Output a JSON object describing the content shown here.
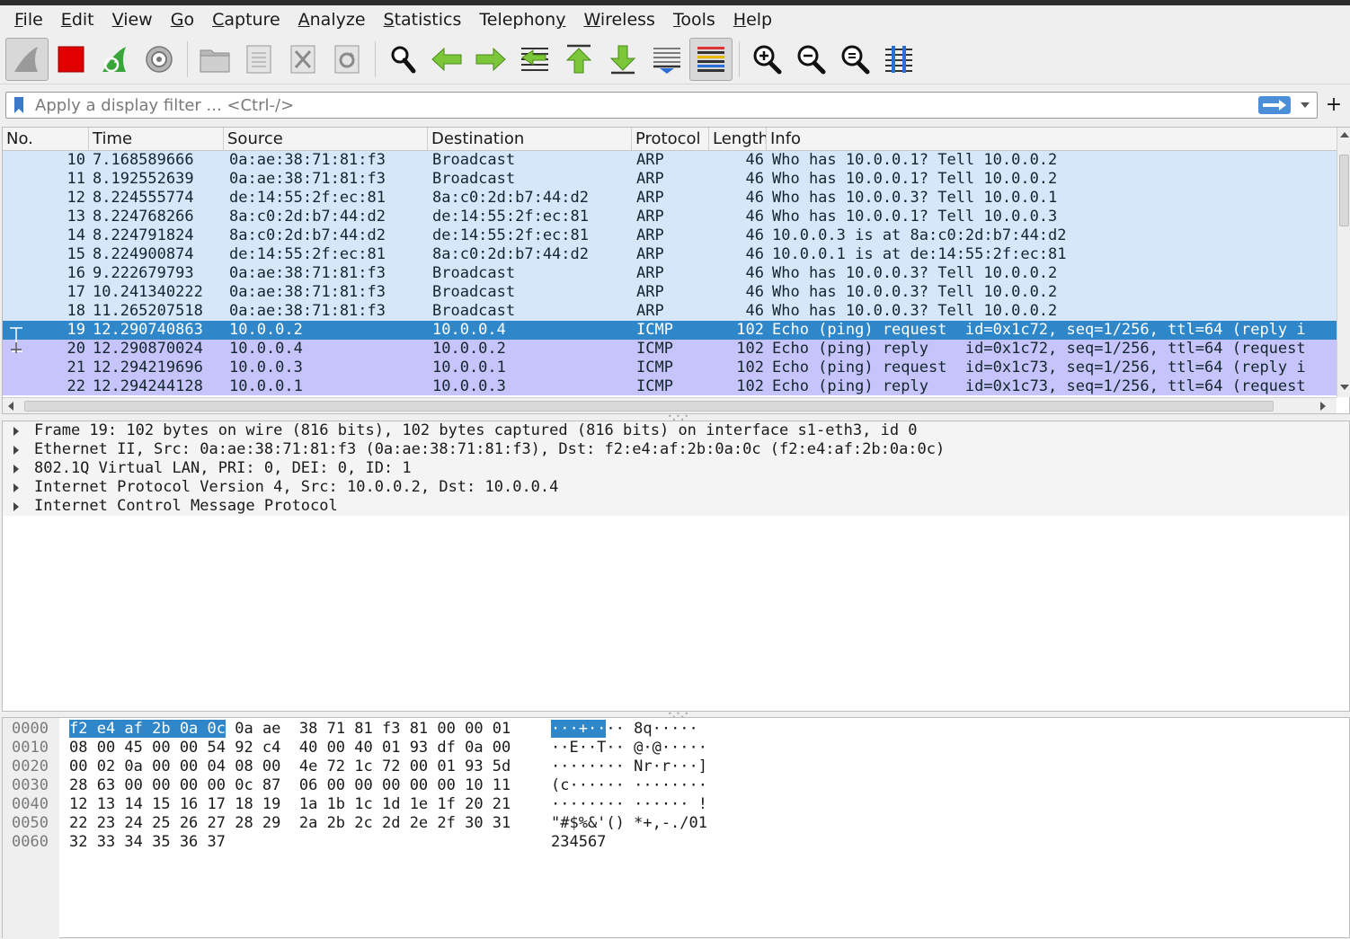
{
  "menu": [
    "File",
    "Edit",
    "View",
    "Go",
    "Capture",
    "Analyze",
    "Statistics",
    "Telephony",
    "Wireless",
    "Tools",
    "Help"
  ],
  "menu_mnemonics": [
    "F",
    "E",
    "V",
    "G",
    "C",
    "A",
    "S",
    "y",
    "W",
    "T",
    "H"
  ],
  "toolbar_icons": [
    "shark-fin-start-icon",
    "stop-capture-icon",
    "restart-capture-icon",
    "capture-options-icon",
    "open-file-icon",
    "save-file-icon",
    "close-file-icon",
    "reload-file-icon",
    "find-packet-icon",
    "go-back-icon",
    "go-forward-icon",
    "go-to-packet-icon",
    "first-packet-icon",
    "last-packet-icon",
    "auto-scroll-icon",
    "colorize-icon",
    "zoom-in-icon",
    "zoom-out-icon",
    "zoom-reset-icon",
    "resize-columns-icon"
  ],
  "filter": {
    "placeholder": "Apply a display filter ... <Ctrl-/>",
    "value": ""
  },
  "columns": [
    "No.",
    "Time",
    "Source",
    "Destination",
    "Protocol",
    "Length",
    "Info"
  ],
  "packets": [
    {
      "no": "10",
      "time": "7.168589666",
      "src": "0a:ae:38:71:81:f3",
      "dst": "Broadcast",
      "proto": "ARP",
      "len": "46",
      "info": "Who has 10.0.0.1? Tell 10.0.0.2",
      "kind": "arp"
    },
    {
      "no": "11",
      "time": "8.192552639",
      "src": "0a:ae:38:71:81:f3",
      "dst": "Broadcast",
      "proto": "ARP",
      "len": "46",
      "info": "Who has 10.0.0.1? Tell 10.0.0.2",
      "kind": "arp"
    },
    {
      "no": "12",
      "time": "8.224555774",
      "src": "de:14:55:2f:ec:81",
      "dst": "8a:c0:2d:b7:44:d2",
      "proto": "ARP",
      "len": "46",
      "info": "Who has 10.0.0.3? Tell 10.0.0.1",
      "kind": "arp"
    },
    {
      "no": "13",
      "time": "8.224768266",
      "src": "8a:c0:2d:b7:44:d2",
      "dst": "de:14:55:2f:ec:81",
      "proto": "ARP",
      "len": "46",
      "info": "Who has 10.0.0.1? Tell 10.0.0.3",
      "kind": "arp"
    },
    {
      "no": "14",
      "time": "8.224791824",
      "src": "8a:c0:2d:b7:44:d2",
      "dst": "de:14:55:2f:ec:81",
      "proto": "ARP",
      "len": "46",
      "info": "10.0.0.3 is at 8a:c0:2d:b7:44:d2",
      "kind": "arp"
    },
    {
      "no": "15",
      "time": "8.224900874",
      "src": "de:14:55:2f:ec:81",
      "dst": "8a:c0:2d:b7:44:d2",
      "proto": "ARP",
      "len": "46",
      "info": "10.0.0.1 is at de:14:55:2f:ec:81",
      "kind": "arp"
    },
    {
      "no": "16",
      "time": "9.222679793",
      "src": "0a:ae:38:71:81:f3",
      "dst": "Broadcast",
      "proto": "ARP",
      "len": "46",
      "info": "Who has 10.0.0.3? Tell 10.0.0.2",
      "kind": "arp"
    },
    {
      "no": "17",
      "time": "10.241340222",
      "src": "0a:ae:38:71:81:f3",
      "dst": "Broadcast",
      "proto": "ARP",
      "len": "46",
      "info": "Who has 10.0.0.3? Tell 10.0.0.2",
      "kind": "arp"
    },
    {
      "no": "18",
      "time": "11.265207518",
      "src": "0a:ae:38:71:81:f3",
      "dst": "Broadcast",
      "proto": "ARP",
      "len": "46",
      "info": "Who has 10.0.0.3? Tell 10.0.0.2",
      "kind": "arp"
    },
    {
      "no": "19",
      "time": "12.290740863",
      "src": "10.0.0.2",
      "dst": "10.0.0.4",
      "proto": "ICMP",
      "len": "102",
      "info": "Echo (ping) request  id=0x1c72, seq=1/256, ttl=64 (reply i",
      "kind": "icmp",
      "selected": true
    },
    {
      "no": "20",
      "time": "12.290870024",
      "src": "10.0.0.4",
      "dst": "10.0.0.2",
      "proto": "ICMP",
      "len": "102",
      "info": "Echo (ping) reply    id=0x1c72, seq=1/256, ttl=64 (request",
      "kind": "icmp"
    },
    {
      "no": "21",
      "time": "12.294219696",
      "src": "10.0.0.3",
      "dst": "10.0.0.1",
      "proto": "ICMP",
      "len": "102",
      "info": "Echo (ping) request  id=0x1c73, seq=1/256, ttl=64 (reply i",
      "kind": "icmp"
    },
    {
      "no": "22",
      "time": "12.294244128",
      "src": "10.0.0.1",
      "dst": "10.0.0.3",
      "proto": "ICMP",
      "len": "102",
      "info": "Echo (ping) reply    id=0x1c73, seq=1/256, ttl=64 (request",
      "kind": "icmp"
    }
  ],
  "details": [
    "Frame 19: 102 bytes on wire (816 bits), 102 bytes captured (816 bits) on interface s1-eth3, id 0",
    "Ethernet II, Src: 0a:ae:38:71:81:f3 (0a:ae:38:71:81:f3), Dst: f2:e4:af:2b:0a:0c (f2:e4:af:2b:0a:0c)",
    "802.1Q Virtual LAN, PRI: 0, DEI: 0, ID: 1",
    "Internet Protocol Version 4, Src: 10.0.0.2, Dst: 10.0.0.4",
    "Internet Control Message Protocol"
  ],
  "bytes": [
    {
      "offset": "0000",
      "hex_hl": "f2 e4 af 2b 0a 0c",
      "hex": " 0a ae  38 71 81 f3 81 00 00 01",
      "ascii_hl": "···+··",
      "ascii": "·· 8q·····"
    },
    {
      "offset": "0010",
      "hex_hl": "",
      "hex": "08 00 45 00 00 54 92 c4  40 00 40 01 93 df 0a 00",
      "ascii_hl": "",
      "ascii": "··E··T·· @·@·····"
    },
    {
      "offset": "0020",
      "hex_hl": "",
      "hex": "00 02 0a 00 00 04 08 00  4e 72 1c 72 00 01 93 5d",
      "ascii_hl": "",
      "ascii": "········ Nr·r···]"
    },
    {
      "offset": "0030",
      "hex_hl": "",
      "hex": "28 63 00 00 00 00 0c 87  06 00 00 00 00 00 10 11",
      "ascii_hl": "",
      "ascii": "(c······ ········"
    },
    {
      "offset": "0040",
      "hex_hl": "",
      "hex": "12 13 14 15 16 17 18 19  1a 1b 1c 1d 1e 1f 20 21",
      "ascii_hl": "",
      "ascii": "········ ······ !"
    },
    {
      "offset": "0050",
      "hex_hl": "",
      "hex": "22 23 24 25 26 27 28 29  2a 2b 2c 2d 2e 2f 30 31",
      "ascii_hl": "",
      "ascii": "\"#$%&'() *+,-./01"
    },
    {
      "offset": "0060",
      "hex_hl": "",
      "hex": "32 33 34 35 36 37",
      "ascii_hl": "",
      "ascii": "234567"
    }
  ],
  "colors": {
    "arp_row": "#d6e7fa",
    "icmp_row": "#c7c4fb",
    "selected_row": "#2f86c8",
    "stop_red": "#e00000",
    "apply_blue": "#4a8fd8"
  }
}
